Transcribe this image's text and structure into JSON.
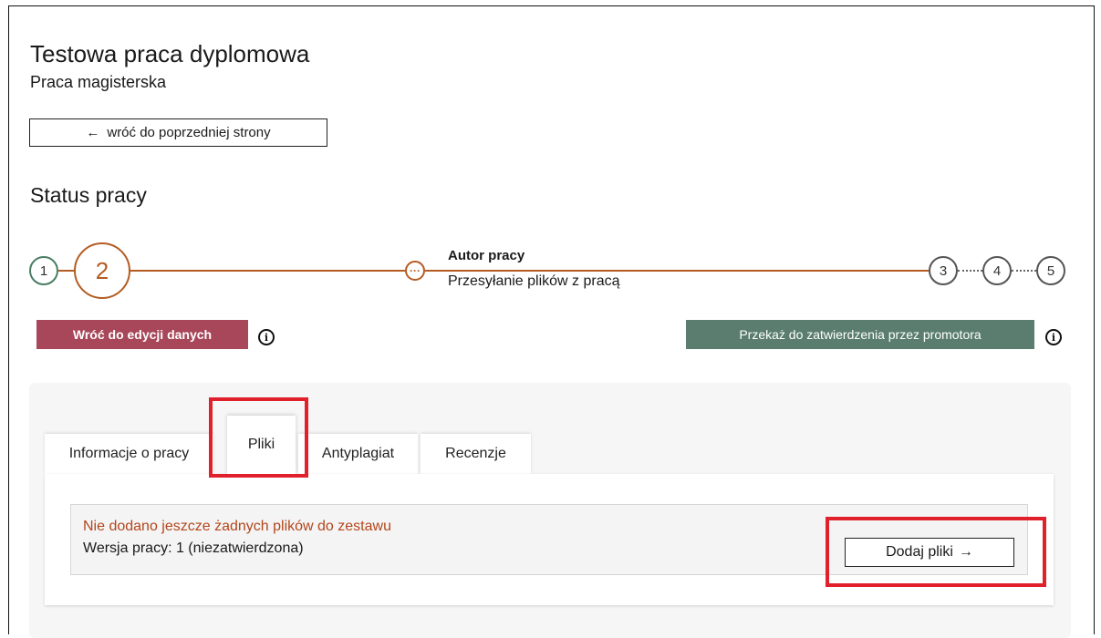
{
  "header": {
    "title": "Testowa praca dyplomowa",
    "subtitle": "Praca magisterska",
    "back_arrow": "←",
    "back_label": "wróć do poprzedniej strony"
  },
  "status": {
    "title": "Status pracy",
    "steps": [
      {
        "number": "1",
        "state": "done"
      },
      {
        "number": "2",
        "state": "active"
      },
      {
        "number": "3",
        "state": "pending"
      },
      {
        "number": "4",
        "state": "pending"
      },
      {
        "number": "5",
        "state": "pending"
      }
    ],
    "substep_icon": "···",
    "current_actor": "Autor pracy",
    "current_action": "Przesyłanie plików z pracą"
  },
  "actions": {
    "back_to_edit": "Wróć do edycji danych",
    "forward_to_promoter": "Przekaż do zatwierdzenia przez promotora",
    "info_icon": "i"
  },
  "tabs": [
    {
      "label": "Informacje o pracy",
      "active": false
    },
    {
      "label": "Pliki",
      "active": true
    },
    {
      "label": "Antyplagiat",
      "active": false
    },
    {
      "label": "Recenzje",
      "active": false
    }
  ],
  "files": {
    "empty_message": "Nie dodano jeszcze żadnych plików do zestawu",
    "version_text": "Wersja pracy: 1 (niezatwierdzona)",
    "add_button": "Dodaj pliki",
    "add_arrow": "→"
  },
  "colors": {
    "accent": "#b45c22",
    "done": "#4a7d64",
    "back_button": "#a8475a",
    "forward_button": "#5a7d70",
    "highlight": "#e0202b",
    "warning_text": "#b3461c"
  }
}
